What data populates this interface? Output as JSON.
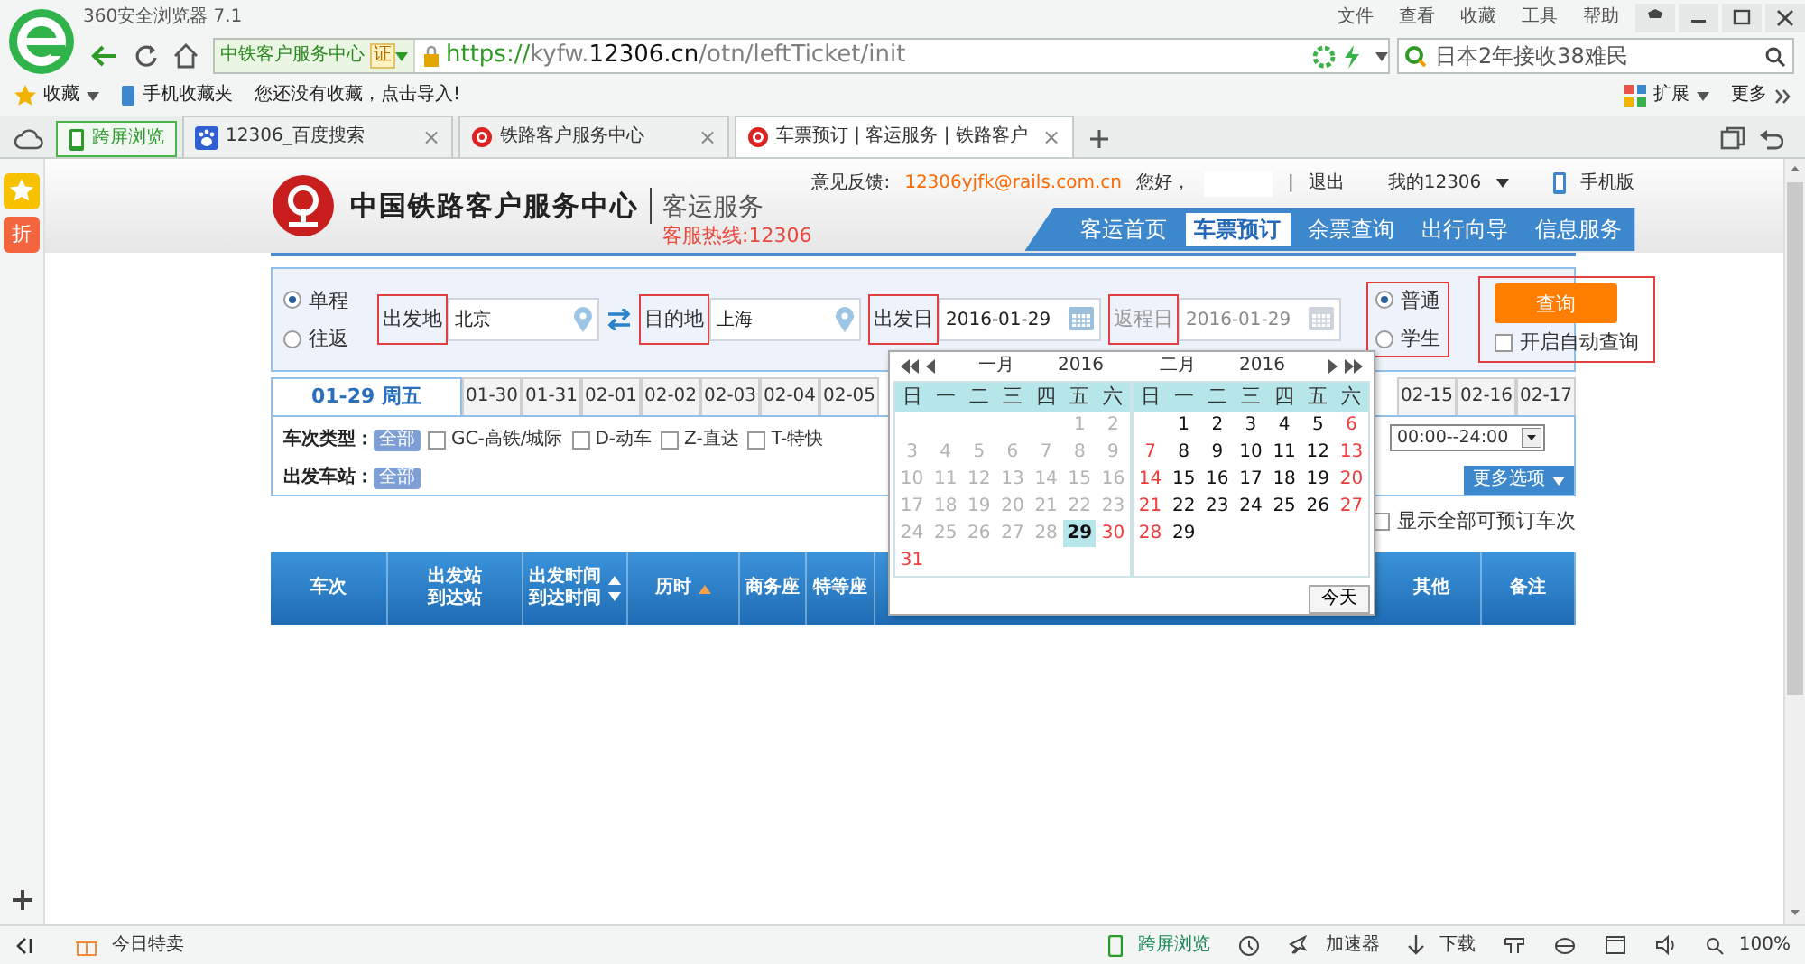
{
  "browser": {
    "title": "360安全浏览器 7.1",
    "menu": [
      "文件",
      "查看",
      "收藏",
      "工具",
      "帮助"
    ],
    "site_label": "中铁客户服务中心",
    "cert_badge": "证",
    "url_parts": [
      {
        "text": "https://",
        "kind": "scheme"
      },
      {
        "text": "kyfw.",
        "kind": "dim"
      },
      {
        "text": "12306.cn",
        "kind": "domain"
      },
      {
        "text": "/otn/leftTicket/init",
        "kind": "dim"
      }
    ],
    "search": {
      "placeholder": "日本2年接收38难民"
    },
    "bookmarks": {
      "favorites": "收藏",
      "mobile": "手机收藏夹",
      "hint": "您还没有收藏，点击导入!",
      "extensions": "扩展",
      "more": "更多"
    },
    "tabs": [
      {
        "label": "跨屏浏览",
        "kind": "cross",
        "selected": false
      },
      {
        "label": "12306_百度搜索",
        "kind": "paw",
        "selected": false,
        "close": "×"
      },
      {
        "label": "铁路客户服务中心",
        "kind": "rail",
        "selected": false,
        "close": "×"
      },
      {
        "label": "车票预订 | 客运服务 | 铁路客户",
        "kind": "rail",
        "selected": true,
        "close": "×"
      }
    ]
  },
  "sidebar": {
    "badge": "折"
  },
  "site_header": {
    "title": "中国铁路客户服务中心",
    "subtitle": "客运服务",
    "hotline": "客服热线:12306",
    "feedback_label": "意见反馈:",
    "feedback_email": "12306yjfk@rails.com.cn",
    "greeting": "您好，",
    "separator": "|",
    "logout": "退出",
    "my_account": "我的12306",
    "mobile": "手机版",
    "nav": [
      {
        "label": "客运首页",
        "selected": false
      },
      {
        "label": "车票预订",
        "selected": true
      },
      {
        "label": "余票查询",
        "selected": false
      },
      {
        "label": "出行向导",
        "selected": false
      },
      {
        "label": "信息服务",
        "selected": false
      }
    ]
  },
  "search_form": {
    "trip_types": [
      {
        "label": "单程",
        "selected": true
      },
      {
        "label": "往返",
        "selected": false
      }
    ],
    "fields": [
      {
        "label": "出发地",
        "value": "北京",
        "kind": "station",
        "marked": true,
        "disabled": false
      },
      {
        "label": "目的地",
        "value": "上海",
        "kind": "station",
        "marked": true,
        "disabled": false
      },
      {
        "label": "出发日",
        "value": "2016-01-29",
        "kind": "date",
        "marked": true,
        "disabled": false
      },
      {
        "label": "返程日",
        "value": "2016-01-29",
        "kind": "date",
        "marked": true,
        "disabled": true
      }
    ],
    "passenger_types": {
      "marked": true,
      "options": [
        {
          "label": "普通",
          "selected": true
        },
        {
          "label": "学生",
          "selected": false
        }
      ]
    },
    "query": {
      "marked": true,
      "button": "查询",
      "auto_query": {
        "label": "开启自动查询",
        "checked": false
      }
    }
  },
  "date_tabs": {
    "left": [
      {
        "label": "01-29 周五",
        "selected": true
      },
      {
        "label": "01-30",
        "selected": false
      },
      {
        "label": "01-31",
        "selected": false
      },
      {
        "label": "02-01",
        "selected": false
      },
      {
        "label": "02-02",
        "selected": false
      },
      {
        "label": "02-03",
        "selected": false
      },
      {
        "label": "02-04",
        "selected": false
      },
      {
        "label": "02-05",
        "selected": false
      }
    ],
    "right": [
      {
        "label": "02-15",
        "selected": false
      },
      {
        "label": "02-16",
        "selected": false
      },
      {
        "label": "02-17",
        "selected": false
      }
    ]
  },
  "filters": {
    "train_type_label": "车次类型：",
    "train_type_all": "全部",
    "train_types": [
      {
        "label": "GC-高铁/城际",
        "checked": false
      },
      {
        "label": "D-动车",
        "checked": false
      },
      {
        "label": "Z-直达",
        "checked": false
      },
      {
        "label": "T-特快",
        "checked": false
      }
    ],
    "station_label": "出发车站：",
    "station_all": "全部",
    "time_range": "00:00--24:00",
    "more_options": "更多选项",
    "show_all": {
      "label": "显示全部可预订车次",
      "checked": false
    }
  },
  "table_header": {
    "left": [
      {
        "lines": [
          "车次"
        ],
        "kind": "plain"
      },
      {
        "lines": [
          "出发站",
          "到达站"
        ],
        "kind": "plain"
      },
      {
        "lines": [
          "出发时间",
          "到达时间"
        ],
        "kind": "sortable"
      },
      {
        "lines": [
          "历时"
        ],
        "kind": "sorted"
      },
      {
        "lines": [
          "商务座"
        ],
        "kind": "plain"
      },
      {
        "lines": [
          "特等座"
        ],
        "kind": "plain"
      }
    ],
    "right": [
      {
        "lines": [
          "其他"
        ],
        "kind": "plain"
      },
      {
        "lines": [
          "备注"
        ],
        "kind": "plain"
      }
    ]
  },
  "calendar": {
    "today_button": "今天",
    "months": [
      {
        "month": "一月",
        "year": "2016",
        "weekdays": [
          "日",
          "一",
          "二",
          "三",
          "四",
          "五",
          "六"
        ],
        "weeks": [
          [
            {
              "kind": "blank"
            },
            {
              "kind": "blank"
            },
            {
              "kind": "blank"
            },
            {
              "kind": "blank"
            },
            {
              "kind": "blank"
            },
            {
              "day": "1",
              "kind": "disabled"
            },
            {
              "day": "2",
              "kind": "disabled"
            }
          ],
          [
            {
              "day": "3",
              "kind": "disabled"
            },
            {
              "day": "4",
              "kind": "disabled"
            },
            {
              "day": "5",
              "kind": "disabled"
            },
            {
              "day": "6",
              "kind": "disabled"
            },
            {
              "day": "7",
              "kind": "disabled"
            },
            {
              "day": "8",
              "kind": "disabled"
            },
            {
              "day": "9",
              "kind": "disabled"
            }
          ],
          [
            {
              "day": "10",
              "kind": "disabled"
            },
            {
              "day": "11",
              "kind": "disabled"
            },
            {
              "day": "12",
              "kind": "disabled"
            },
            {
              "day": "13",
              "kind": "disabled"
            },
            {
              "day": "14",
              "kind": "disabled"
            },
            {
              "day": "15",
              "kind": "disabled"
            },
            {
              "day": "16",
              "kind": "disabled"
            }
          ],
          [
            {
              "day": "17",
              "kind": "disabled"
            },
            {
              "day": "18",
              "kind": "disabled"
            },
            {
              "day": "19",
              "kind": "disabled"
            },
            {
              "day": "20",
              "kind": "disabled"
            },
            {
              "day": "21",
              "kind": "disabled"
            },
            {
              "day": "22",
              "kind": "disabled"
            },
            {
              "day": "23",
              "kind": "disabled"
            }
          ],
          [
            {
              "day": "24",
              "kind": "disabled"
            },
            {
              "day": "25",
              "kind": "disabled"
            },
            {
              "day": "26",
              "kind": "disabled"
            },
            {
              "day": "27",
              "kind": "disabled"
            },
            {
              "day": "28",
              "kind": "disabled"
            },
            {
              "day": "29",
              "kind": "selected"
            },
            {
              "day": "30",
              "kind": "weekend"
            }
          ],
          [
            {
              "day": "31",
              "kind": "weekend"
            }
          ]
        ]
      },
      {
        "month": "二月",
        "year": "2016",
        "weekdays": [
          "日",
          "一",
          "二",
          "三",
          "四",
          "五",
          "六"
        ],
        "weeks": [
          [
            {
              "kind": "blank"
            },
            {
              "day": "1",
              "kind": "normal"
            },
            {
              "day": "2",
              "kind": "normal"
            },
            {
              "day": "3",
              "kind": "normal"
            },
            {
              "day": "4",
              "kind": "normal"
            },
            {
              "day": "5",
              "kind": "normal"
            },
            {
              "day": "6",
              "kind": "weekend"
            }
          ],
          [
            {
              "day": "7",
              "kind": "weekend"
            },
            {
              "day": "8",
              "kind": "normal"
            },
            {
              "day": "9",
              "kind": "normal"
            },
            {
              "day": "10",
              "kind": "normal"
            },
            {
              "day": "11",
              "kind": "normal"
            },
            {
              "day": "12",
              "kind": "normal"
            },
            {
              "day": "13",
              "kind": "weekend"
            }
          ],
          [
            {
              "day": "14",
              "kind": "weekend"
            },
            {
              "day": "15",
              "kind": "normal"
            },
            {
              "day": "16",
              "kind": "normal"
            },
            {
              "day": "17",
              "kind": "normal"
            },
            {
              "day": "18",
              "kind": "normal"
            },
            {
              "day": "19",
              "kind": "normal"
            },
            {
              "day": "20",
              "kind": "weekend"
            }
          ],
          [
            {
              "day": "21",
              "kind": "weekend"
            },
            {
              "day": "22",
              "kind": "normal"
            },
            {
              "day": "23",
              "kind": "normal"
            },
            {
              "day": "24",
              "kind": "normal"
            },
            {
              "day": "25",
              "kind": "normal"
            },
            {
              "day": "26",
              "kind": "normal"
            },
            {
              "day": "27",
              "kind": "weekend"
            }
          ],
          [
            {
              "day": "28",
              "kind": "weekend"
            },
            {
              "day": "29",
              "kind": "normal"
            }
          ]
        ]
      }
    ]
  },
  "status_bar": {
    "deals": "今日特卖",
    "cross_screen": "跨屏浏览",
    "accelerator": "加速器",
    "download": "下载",
    "zoom": "100%"
  }
}
